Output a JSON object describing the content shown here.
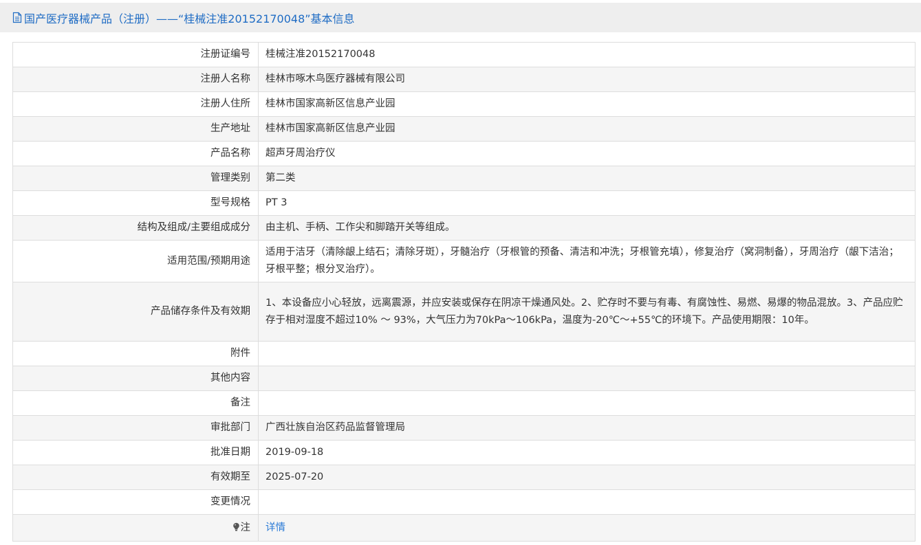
{
  "header": {
    "icon": "document-icon",
    "title": "国产医疗器械产品（注册）——“桂械注准20152170048”基本信息"
  },
  "rows": [
    {
      "label": "注册证编号",
      "value": "桂械注准20152170048"
    },
    {
      "label": "注册人名称",
      "value": "桂林市啄木鸟医疗器械有限公司"
    },
    {
      "label": "注册人住所",
      "value": "桂林市国家高新区信息产业园"
    },
    {
      "label": "生产地址",
      "value": "桂林市国家高新区信息产业园"
    },
    {
      "label": "产品名称",
      "value": "超声牙周治疗仪"
    },
    {
      "label": "管理类别",
      "value": "第二类"
    },
    {
      "label": "型号规格",
      "value": "PT 3"
    },
    {
      "label": "结构及组成/主要组成成分",
      "value": "由主机、手柄、工作尖和脚踏开关等组成。"
    },
    {
      "label": "适用范围/预期用途",
      "value": "适用于洁牙（清除龈上结石；清除牙斑），牙髓治疗（牙根管的预备、清洁和冲洗；牙根管充填），修复治疗（窝洞制备），牙周治疗（龈下洁治；牙根平整；根分叉治疗）。"
    },
    {
      "label": "产品储存条件及有效期",
      "value": "1、本设备应小心轻放，远离震源，并应安装或保存在阴凉干燥通风处。2、贮存时不要与有毒、有腐蚀性、易燃、易爆的物品混放。3、产品应贮存于相对湿度不超过10% ～ 93%，大气压力为70kPa～106kPa，温度为-20℃～+55℃的环境下。产品使用期限：10年。"
    },
    {
      "label": "附件",
      "value": ""
    },
    {
      "label": "其他内容",
      "value": ""
    },
    {
      "label": "备注",
      "value": ""
    },
    {
      "label": "审批部门",
      "value": "广西壮族自治区药品监督管理局"
    },
    {
      "label": "批准日期",
      "value": "2019-09-18"
    },
    {
      "label": "有效期至",
      "value": "2025-07-20"
    },
    {
      "label": "变更情况",
      "value": ""
    }
  ],
  "note_row": {
    "icon": "lightbulb-icon",
    "label": "注",
    "link_text": "详情"
  },
  "colors": {
    "header_text": "#1f6cc4",
    "header_bg": "#eeeeee",
    "link": "#2b7bd6",
    "border": "#dddddd",
    "stripe": "#f5f5f5"
  }
}
